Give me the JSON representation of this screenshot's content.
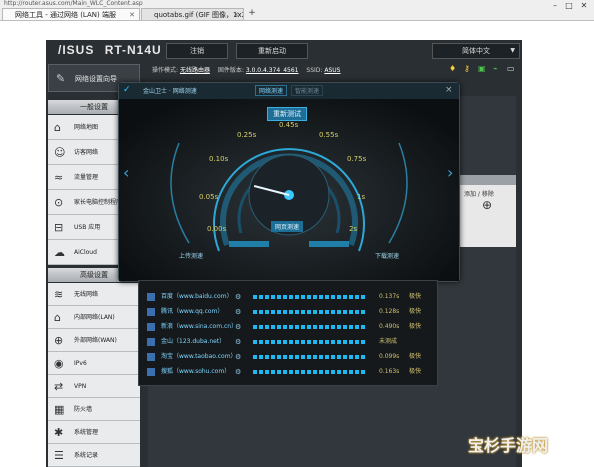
{
  "browser": {
    "address": "http://router.asus.com/Main_WLC_Content.asp",
    "tabs": [
      {
        "label": "网络工具 - 通过网络 (LAN) 端服"
      },
      {
        "label": "quotabs.gif (GIF 图像，1x24 像素)"
      }
    ],
    "new_tab": "+",
    "window_controls": [
      "–",
      "□",
      "✕"
    ]
  },
  "router": {
    "brand": "/ISUS",
    "model": "RT-N14U",
    "logout_label": "注销",
    "reboot_label": "重新启动",
    "language_label": "简体中文",
    "status": {
      "mode_label": "操作模式:",
      "mode_value": "无线路由器",
      "firmware_label": "固件版本:",
      "firmware_value": "3.0.0.4.374_4561",
      "ssid_label": "SSID:",
      "ssid_value": "ASUS"
    },
    "status_icons": [
      "lightbulb-icon",
      "key-icon",
      "network-icon",
      "usb-icon",
      "screen-icon"
    ],
    "quick_setup": "网络设置向导",
    "general_header": "一般设置",
    "general_items": [
      {
        "label": "网络地图",
        "icon": "⌂",
        "icon_name": "network-map-icon"
      },
      {
        "label": "访客网络",
        "icon": "☺",
        "icon_name": "guest-network-icon"
      },
      {
        "label": "流量管理",
        "icon": "≈",
        "icon_name": "traffic-manager-icon"
      },
      {
        "label": "家长电脑控制程序",
        "icon": "⊙",
        "icon_name": "parental-control-icon"
      },
      {
        "label": "USB 应用",
        "icon": "⊟",
        "icon_name": "usb-application-icon"
      },
      {
        "label": "AiCloud",
        "icon": "☁",
        "icon_name": "aicloud-icon"
      }
    ],
    "advanced_header": "高级设置",
    "advanced_items": [
      {
        "label": "无线网络",
        "icon": "≋",
        "icon_name": "wireless-icon"
      },
      {
        "label": "内部网络(LAN)",
        "icon": "⌂",
        "icon_name": "lan-icon"
      },
      {
        "label": "外部网络(WAN)",
        "icon": "⊕",
        "icon_name": "wan-icon"
      },
      {
        "label": "IPv6",
        "icon": "◉",
        "icon_name": "ipv6-icon"
      },
      {
        "label": "VPN",
        "icon": "⇄",
        "icon_name": "vpn-icon"
      },
      {
        "label": "防火墙",
        "icon": "▦",
        "icon_name": "firewall-icon"
      },
      {
        "label": "系统管理",
        "icon": "✱",
        "icon_name": "administration-icon"
      },
      {
        "label": "系统记录",
        "icon": "☰",
        "icon_name": "system-log-icon"
      }
    ],
    "right_header": "添加 / 移除",
    "right_add": "⊕"
  },
  "speedtest": {
    "title": "金山卫士 · 网络测速",
    "tabs": [
      "网络测速",
      "智能测速"
    ],
    "retest_label": "重新测试",
    "ticks": [
      "0.00s",
      "0.05s",
      "0.10s",
      "0.25s",
      "0.45s",
      "0.55s",
      "0.75s",
      "1s",
      "2s"
    ],
    "center_label": "网页测速",
    "upload_label": "上传测速",
    "download_label": "下载测速",
    "close": "×",
    "pin": "✓",
    "prev": "‹",
    "next": "›",
    "needle": 0.22
  },
  "results": [
    {
      "site": "百度（www.baidu.com）",
      "time": "0.137s",
      "level": "极快"
    },
    {
      "site": "腾讯（www.qq.com）",
      "time": "0.128s",
      "level": "极快"
    },
    {
      "site": "新浪（www.sina.com.cn）",
      "time": "0.490s",
      "level": "极快"
    },
    {
      "site": "金山（123.duba.net）",
      "time": "未测成",
      "level": ""
    },
    {
      "site": "淘宝（www.taobao.com）",
      "time": "0.099s",
      "level": "极快"
    },
    {
      "site": "搜狐（www.sohu.com）",
      "time": "0.163s",
      "level": "极快"
    }
  ],
  "watermark": "宝杉手游网"
}
